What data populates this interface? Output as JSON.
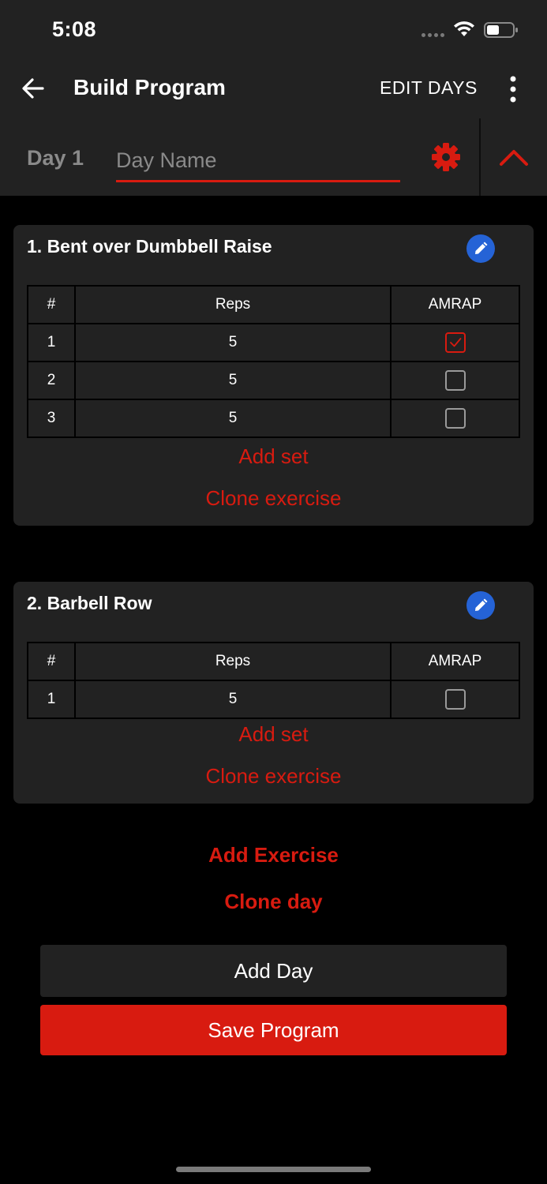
{
  "status_bar": {
    "time": "5:08"
  },
  "app_bar": {
    "title": "Build Program",
    "edit_days_label": "EDIT DAYS"
  },
  "day": {
    "label": "Day 1",
    "name_placeholder": "Day Name",
    "name_value": ""
  },
  "table_headers": {
    "num": "#",
    "reps": "Reps",
    "amrap": "AMRAP"
  },
  "exercises": [
    {
      "title": "1. Bent over Dumbbell Raise",
      "sets": [
        {
          "num": "1",
          "reps": "5",
          "amrap": true
        },
        {
          "num": "2",
          "reps": "5",
          "amrap": false
        },
        {
          "num": "3",
          "reps": "5",
          "amrap": false
        }
      ],
      "add_set_label": "Add set",
      "clone_label": "Clone exercise"
    },
    {
      "title": "2. Barbell Row",
      "sets": [
        {
          "num": "1",
          "reps": "5",
          "amrap": false
        }
      ],
      "add_set_label": "Add set",
      "clone_label": "Clone exercise"
    }
  ],
  "actions": {
    "add_exercise": "Add Exercise",
    "clone_day": "Clone day",
    "add_day": "Add Day",
    "save_program": "Save Program"
  },
  "colors": {
    "accent": "#d81b10",
    "surface": "#222222",
    "background": "#000000",
    "edit_badge": "#2563d6"
  },
  "icons": [
    "back-arrow-icon",
    "more-vertical-icon",
    "gear-icon",
    "chevron-up-icon",
    "pencil-icon",
    "checkmark-icon",
    "wifi-icon",
    "battery-icon",
    "signal-icon"
  ]
}
